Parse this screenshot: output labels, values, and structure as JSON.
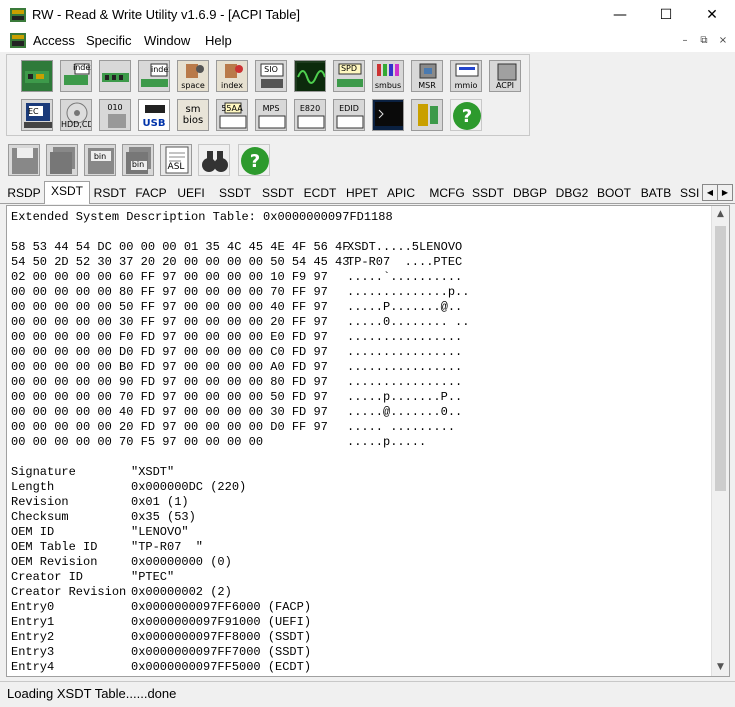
{
  "window": {
    "title": "RW - Read & Write Utility v1.6.9 - [ACPI Table]",
    "minimize": "—",
    "maximize": "☐",
    "close": "✕"
  },
  "menu": {
    "items": [
      "Access",
      "Specific",
      "Window",
      "Help"
    ],
    "mdi": [
      "–",
      "⧉",
      "×"
    ]
  },
  "toolbar": {
    "row1": [
      "",
      "index",
      "",
      "index",
      "space",
      "index",
      "SIO",
      "",
      "SPD",
      "smbus",
      "MSR",
      "mmio",
      "ACPI"
    ],
    "row2": [
      "EC",
      "HDD,CD",
      "010",
      "USB",
      "sm bios",
      "55AA",
      "MPS",
      "E820",
      "EDID",
      "",
      "",
      "?"
    ],
    "row3": [
      "",
      "",
      "bin",
      "bin",
      "ASL",
      "",
      "?"
    ]
  },
  "tabs": [
    "RSDP",
    "XSDT",
    "RSDT",
    "FACP",
    "UEFI",
    "SSDT",
    "SSDT",
    "ECDT",
    "HPET",
    "APIC",
    "MCFG",
    "SSDT",
    "DBGP",
    "DBG2",
    "BOOT",
    "BATB",
    "SSI"
  ],
  "active_tab": "XSDT",
  "table": {
    "header": "Extended System Description Table: 0x0000000097FD1188",
    "hex_rows": [
      [
        "58 53 44 54 DC 00 00 00 01 35 4C 45 4E 4F 56 4F",
        "XSDT.....5LENOVO"
      ],
      [
        "54 50 2D 52 30 37 20 20 00 00 00 00 50 54 45 43",
        "TP-R07  ....PTEC"
      ],
      [
        "02 00 00 00 00 60 FF 97 00 00 00 00 10 F9 97",
        ".....`.........."
      ],
      [
        "00 00 00 00 00 80 FF 97 00 00 00 00 70 FF 97",
        "..............p.."
      ],
      [
        "00 00 00 00 00 50 FF 97 00 00 00 00 40 FF 97",
        ".....P.......@.."
      ],
      [
        "00 00 00 00 00 30 FF 97 00 00 00 00 20 FF 97",
        ".....0........ .."
      ],
      [
        "00 00 00 00 00 F0 FD 97 00 00 00 00 E0 FD 97",
        "................"
      ],
      [
        "00 00 00 00 00 D0 FD 97 00 00 00 00 C0 FD 97",
        "................"
      ],
      [
        "00 00 00 00 00 B0 FD 97 00 00 00 00 A0 FD 97",
        "................"
      ],
      [
        "00 00 00 00 00 90 FD 97 00 00 00 00 80 FD 97",
        "................"
      ],
      [
        "00 00 00 00 00 70 FD 97 00 00 00 00 50 FD 97",
        ".....p.......P.."
      ],
      [
        "00 00 00 00 00 40 FD 97 00 00 00 00 30 FD 97",
        ".....@.......0.."
      ],
      [
        "00 00 00 00 00 20 FD 97 00 00 00 00 D0 FF 97",
        "..... ........."
      ],
      [
        "00 00 00 00 00 70 F5 97 00 00 00 00",
        ".....p....."
      ]
    ],
    "fields": [
      [
        "Signature",
        "\"XSDT\""
      ],
      [
        "Length",
        "0x000000DC (220)"
      ],
      [
        "Revision",
        "0x01 (1)"
      ],
      [
        "Checksum",
        "0x35 (53)"
      ],
      [
        "OEM ID",
        "\"LENOVO\""
      ],
      [
        "OEM Table ID",
        "\"TP-R07  \""
      ],
      [
        "OEM Revision",
        "0x00000000 (0)"
      ],
      [
        "Creator ID",
        "\"PTEC\""
      ],
      [
        "Creator Revision",
        "0x00000002 (2)"
      ],
      [
        "Entry0",
        "0x0000000097FF6000 (FACP)"
      ],
      [
        "Entry1",
        "0x0000000097F91000 (UEFI)"
      ],
      [
        "Entry2",
        "0x0000000097FF8000 (SSDT)"
      ],
      [
        "Entry3",
        "0x0000000097FF7000 (SSDT)"
      ],
      [
        "Entry4",
        "0x0000000097FF5000 (ECDT)"
      ]
    ]
  },
  "status": "Loading XSDT Table......done"
}
